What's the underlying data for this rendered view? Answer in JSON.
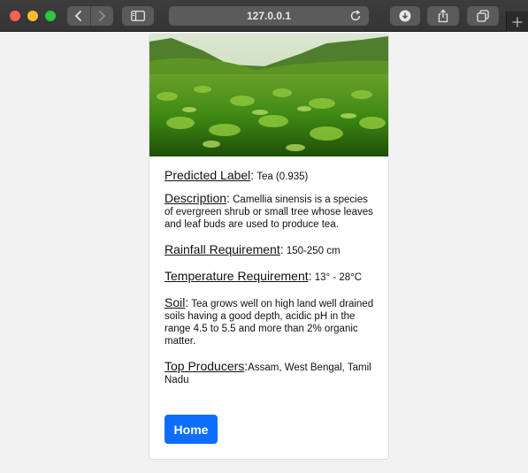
{
  "browser": {
    "url": "127.0.0.1"
  },
  "result": {
    "predicted_label": {
      "label": "Predicted Label",
      "value": "Tea (0.935)"
    },
    "description": {
      "label": "Description",
      "value": "Camellia sinensis is a species of evergreen shrub or small tree whose leaves and leaf buds are used to produce tea."
    },
    "rainfall": {
      "label": "Rainfall Requirement",
      "value": "150-250 cm"
    },
    "temperature": {
      "label": "Temperature Requirement",
      "value": "13° - 28°C"
    },
    "soil": {
      "label": "Soil",
      "value": "Tea grows well on high land well drained soils having a good depth, acidic pH in the range 4.5 to 5.5 and more than 2% organic matter."
    },
    "producers": {
      "label": "Top Producers",
      "value": "Assam, West Bengal, Tamil Nadu"
    }
  },
  "actions": {
    "home_label": "Home"
  },
  "colors": {
    "accent": "#0d6efd",
    "toolbar": "#3a3a3a",
    "page_bg": "#f2f2f2"
  }
}
